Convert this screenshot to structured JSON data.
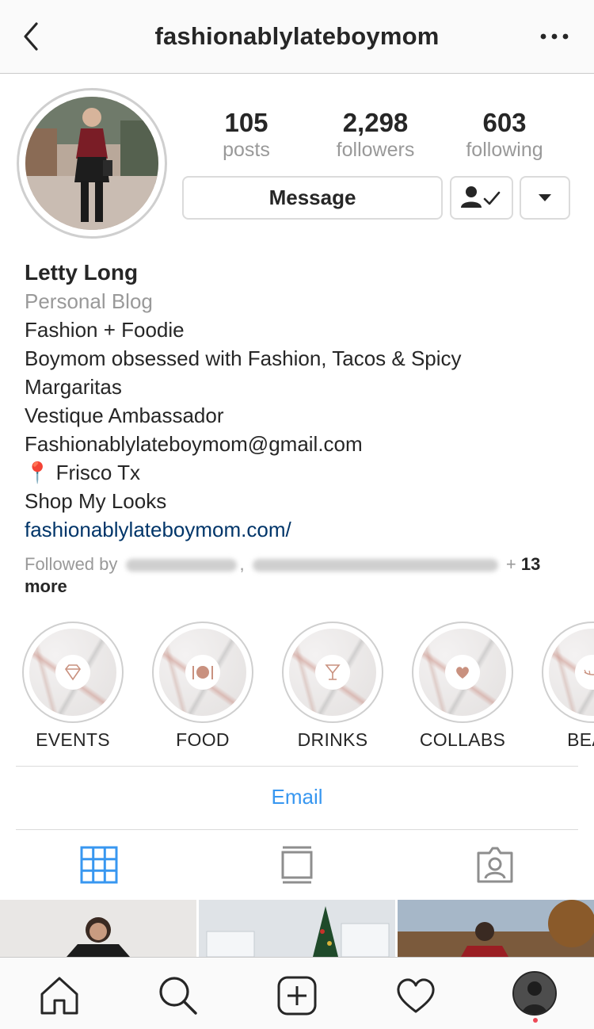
{
  "header": {
    "username": "fashionablylateboymom"
  },
  "stats": {
    "posts": {
      "value": "105",
      "label": "posts"
    },
    "followers": {
      "value": "2,298",
      "label": "followers"
    },
    "following": {
      "value": "603",
      "label": "following"
    }
  },
  "actions": {
    "message_label": "Message"
  },
  "bio": {
    "name": "Letty Long",
    "category": "Personal Blog",
    "lines": [
      "Fashion + Foodie",
      "Boymom obsessed with Fashion, Tacos & Spicy",
      "Margaritas",
      "Vestique Ambassador",
      "Fashionablylateboymom@gmail.com",
      "📍 Frisco Tx",
      "Shop My Looks"
    ],
    "link": "fashionablylateboymom.com/"
  },
  "followed_by": {
    "prefix": "Followed by",
    "separator": ",",
    "suffix": "+",
    "count": "13",
    "more": "more"
  },
  "highlights": [
    {
      "label": "EVENTS",
      "icon": "diamond-icon"
    },
    {
      "label": "FOOD",
      "icon": "plate-icon"
    },
    {
      "label": "DRINKS",
      "icon": "cocktail-icon"
    },
    {
      "label": "COLLABS",
      "icon": "heart-icon"
    },
    {
      "label": "BEAU",
      "icon": "eyelash-icon"
    }
  ],
  "contact": {
    "email_label": "Email"
  },
  "tabs": [
    {
      "name": "grid-view",
      "icon": "grid-icon",
      "active": true
    },
    {
      "name": "feed-view",
      "icon": "feed-icon",
      "active": false
    },
    {
      "name": "tagged-view",
      "icon": "tagged-icon",
      "active": false
    }
  ],
  "bottom_nav": [
    "home-icon",
    "search-icon",
    "new-post-icon",
    "activity-heart-icon",
    "profile-avatar"
  ],
  "colors": {
    "accent_blue": "#3897f0",
    "link_blue": "#003569",
    "muted_gray": "#999999",
    "text": "#262626",
    "rose_gold": "#c9917f",
    "notification_red": "#ed4956"
  }
}
